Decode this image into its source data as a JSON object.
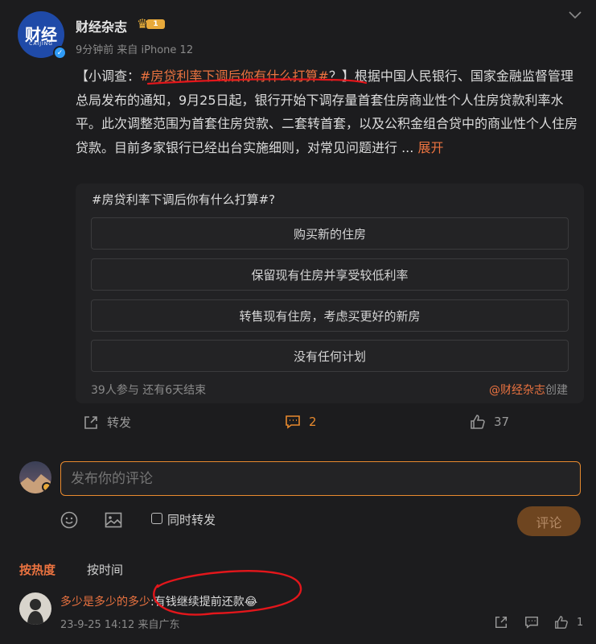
{
  "post": {
    "user_name": "财经杂志",
    "badge_level": "1",
    "avatar_text": "财经",
    "avatar_sub": "CAIJING",
    "meta": "9分钟前  来自 iPhone 12",
    "text_prefix": "【小调查：",
    "hashtag": "#房贷利率下调后你有什么打算#",
    "text_body": "？】根据中国人民银行、国家金融监督管理总局发布的通知，9月25日起，银行开始下调存量首套住房商业性个人住房贷款利率水平。此次调整范围为首套住房贷款、二套转首套，以及公积金组合贷中的商业性个人住房贷款。目前多家银行已经出台实施细则，对常见问题进行 ...",
    "expand": "展开"
  },
  "poll": {
    "title": "#房贷利率下调后你有什么打算#?",
    "options": [
      "购买新的住房",
      "保留现有住房并享受较低利率",
      "转售现有住房，考虑买更好的新房",
      "没有任何计划"
    ],
    "status": "39人参与  还有6天结束",
    "creator_at": "@财经杂志",
    "creator_suffix": "创建"
  },
  "actions": {
    "repost": "转发",
    "comments": "2",
    "likes": "37"
  },
  "composer": {
    "placeholder": "发布你的评论",
    "repost_label": "同时转发",
    "submit": "评论"
  },
  "sort": {
    "hot": "按热度",
    "time": "按时间"
  },
  "comment": {
    "user": "多少是多少的多少",
    "text": ":有钱继续提前还款😂",
    "meta": "23-9-25 14:12  来自广东",
    "likes": "1"
  }
}
